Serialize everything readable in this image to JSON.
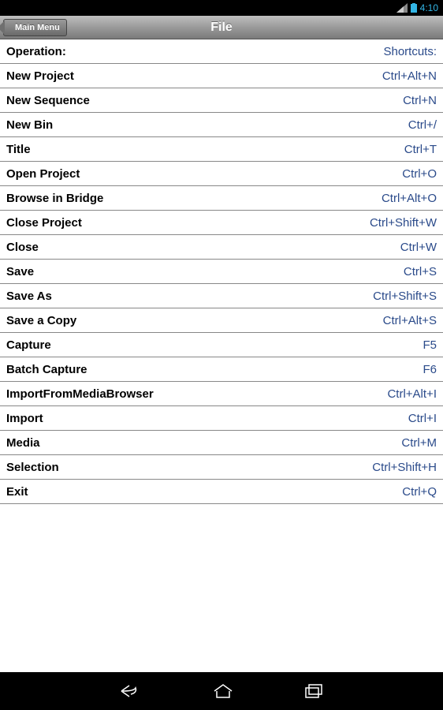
{
  "status": {
    "time": "4:10"
  },
  "appbar": {
    "back_label": "Main Menu",
    "title": "File"
  },
  "header": {
    "operation_label": "Operation:",
    "shortcuts_label": "Shortcuts:"
  },
  "rows": [
    {
      "op": "New Project",
      "sc": "Ctrl+Alt+N"
    },
    {
      "op": "New Sequence",
      "sc": "Ctrl+N"
    },
    {
      "op": "New Bin",
      "sc": "Ctrl+/"
    },
    {
      "op": "Title",
      "sc": "Ctrl+T"
    },
    {
      "op": "Open Project",
      "sc": "Ctrl+O"
    },
    {
      "op": "Browse in Bridge",
      "sc": "Ctrl+Alt+O"
    },
    {
      "op": "Close Project",
      "sc": "Ctrl+Shift+W"
    },
    {
      "op": "Close",
      "sc": "Ctrl+W"
    },
    {
      "op": "Save",
      "sc": "Ctrl+S"
    },
    {
      "op": "Save As",
      "sc": "Ctrl+Shift+S"
    },
    {
      "op": "Save a Copy",
      "sc": "Ctrl+Alt+S"
    },
    {
      "op": "Capture",
      "sc": "F5"
    },
    {
      "op": "Batch Capture",
      "sc": "F6"
    },
    {
      "op": "ImportFromMediaBrowser",
      "sc": "Ctrl+Alt+I"
    },
    {
      "op": "Import",
      "sc": "Ctrl+I"
    },
    {
      "op": "Media",
      "sc": "Ctrl+M"
    },
    {
      "op": "Selection",
      "sc": "Ctrl+Shift+H"
    },
    {
      "op": "Exit",
      "sc": "Ctrl+Q"
    }
  ]
}
